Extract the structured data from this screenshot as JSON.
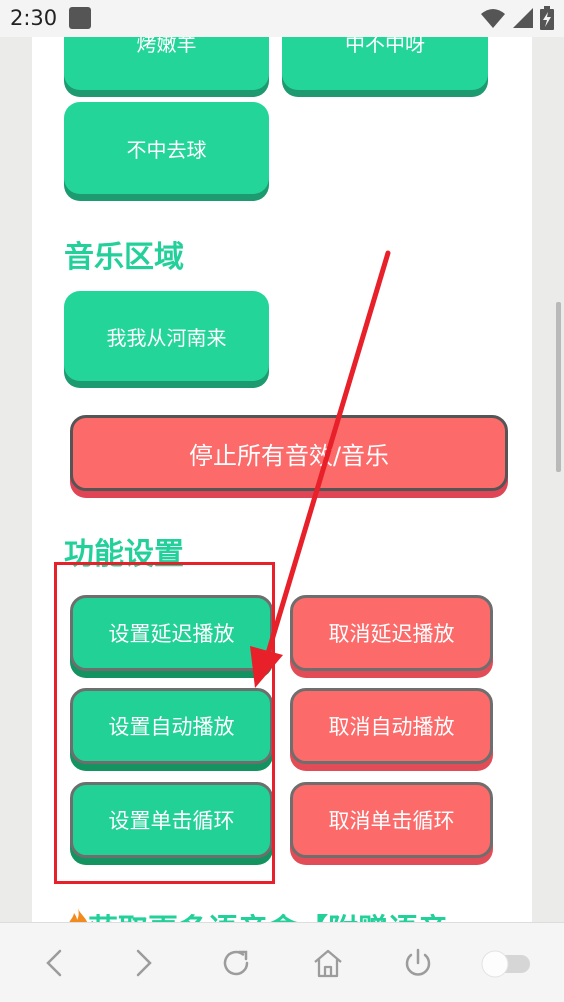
{
  "status_bar": {
    "time": "2:30",
    "icons": [
      "app-notification-icon",
      "wifi-icon",
      "signal-icon",
      "battery-charging-icon"
    ]
  },
  "sound_buttons": {
    "partial_left": "烤嫩羊",
    "partial_right": "中不中呀",
    "item": "不中去球"
  },
  "music_section": {
    "title": "音乐区域",
    "item": "我我从河南来"
  },
  "stop_button": {
    "label": "停止所有音效/音乐"
  },
  "settings_section": {
    "title": "功能设置",
    "set_delay": "设置延迟播放",
    "cancel_delay": "取消延迟播放",
    "set_autoplay": "设置自动播放",
    "cancel_autoplay": "取消自动播放",
    "set_loop": "设置单击循环",
    "cancel_loop": "取消单击循环"
  },
  "more_section": {
    "title": "获取更多语音盒【附赠语音"
  },
  "nav_bar": {
    "icons": [
      "back-icon",
      "forward-icon",
      "refresh-icon",
      "home-icon",
      "power-icon",
      "toggle-icon"
    ]
  },
  "colors": {
    "green": "#22d196",
    "red": "#fd6a6a",
    "annotation": "#e8202a"
  }
}
